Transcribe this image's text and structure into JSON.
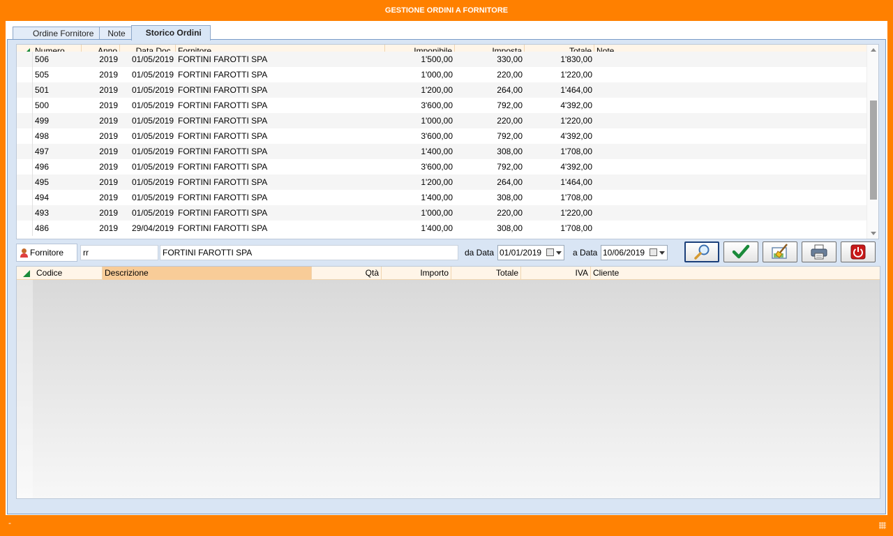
{
  "window": {
    "title": "GESTIONE ORDINI A FORNITORE"
  },
  "tabs": [
    {
      "label": "Ordine Fornitore"
    },
    {
      "label": "Note"
    },
    {
      "label": "Storico Ordini"
    }
  ],
  "orders_grid": {
    "columns": [
      "Numero",
      "Anno",
      "Data Doc.",
      "Fornitore",
      "Imponibile",
      "Imposta",
      "Totale",
      "Note"
    ],
    "rows": [
      [
        "506",
        "2019",
        "01/05/2019",
        "FORTINI FAROTTI SPA",
        "1'500,00",
        "330,00",
        "1'830,00",
        ""
      ],
      [
        "505",
        "2019",
        "01/05/2019",
        "FORTINI FAROTTI SPA",
        "1'000,00",
        "220,00",
        "1'220,00",
        ""
      ],
      [
        "501",
        "2019",
        "01/05/2019",
        "FORTINI FAROTTI SPA",
        "1'200,00",
        "264,00",
        "1'464,00",
        ""
      ],
      [
        "500",
        "2019",
        "01/05/2019",
        "FORTINI FAROTTI SPA",
        "3'600,00",
        "792,00",
        "4'392,00",
        ""
      ],
      [
        "499",
        "2019",
        "01/05/2019",
        "FORTINI FAROTTI SPA",
        "1'000,00",
        "220,00",
        "1'220,00",
        ""
      ],
      [
        "498",
        "2019",
        "01/05/2019",
        "FORTINI FAROTTI SPA",
        "3'600,00",
        "792,00",
        "4'392,00",
        ""
      ],
      [
        "497",
        "2019",
        "01/05/2019",
        "FORTINI FAROTTI SPA",
        "1'400,00",
        "308,00",
        "1'708,00",
        ""
      ],
      [
        "496",
        "2019",
        "01/05/2019",
        "FORTINI FAROTTI SPA",
        "3'600,00",
        "792,00",
        "4'392,00",
        ""
      ],
      [
        "495",
        "2019",
        "01/05/2019",
        "FORTINI FAROTTI SPA",
        "1'200,00",
        "264,00",
        "1'464,00",
        ""
      ],
      [
        "494",
        "2019",
        "01/05/2019",
        "FORTINI FAROTTI SPA",
        "1'400,00",
        "308,00",
        "1'708,00",
        ""
      ],
      [
        "493",
        "2019",
        "01/05/2019",
        "FORTINI FAROTTI SPA",
        "1'000,00",
        "220,00",
        "1'220,00",
        ""
      ],
      [
        "486",
        "2019",
        "29/04/2019",
        "FORTINI FAROTTI SPA",
        "1'400,00",
        "308,00",
        "1'708,00",
        ""
      ]
    ]
  },
  "filter": {
    "supplier_button_label": "Fornitore",
    "supplier_code": "rr",
    "supplier_name": "FORTINI FAROTTI SPA",
    "from_label": "da Data",
    "from_date": "01/01/2019",
    "to_label": "a Data",
    "to_date": "10/06/2019"
  },
  "toolbar": {
    "buttons": [
      {
        "icon": "magnifier-icon"
      },
      {
        "icon": "checkmark-icon"
      },
      {
        "icon": "broom-icon"
      },
      {
        "icon": "printer-icon"
      },
      {
        "icon": "power-icon"
      }
    ],
    "accent_green": "#1a8a3a",
    "accent_red": "#c81818"
  },
  "details_grid": {
    "columns": [
      "Codice",
      "Descrizione",
      "Qtà",
      "Importo",
      "Totale",
      "IVA",
      "Cliente"
    ],
    "sorted_column": "Descrizione",
    "rows": []
  },
  "status": {
    "text": "-"
  },
  "colors": {
    "chrome": "#ff8000",
    "panel": "#d9e5f4",
    "header": "#fff5e8",
    "sorted_header": "#f8cc98"
  }
}
